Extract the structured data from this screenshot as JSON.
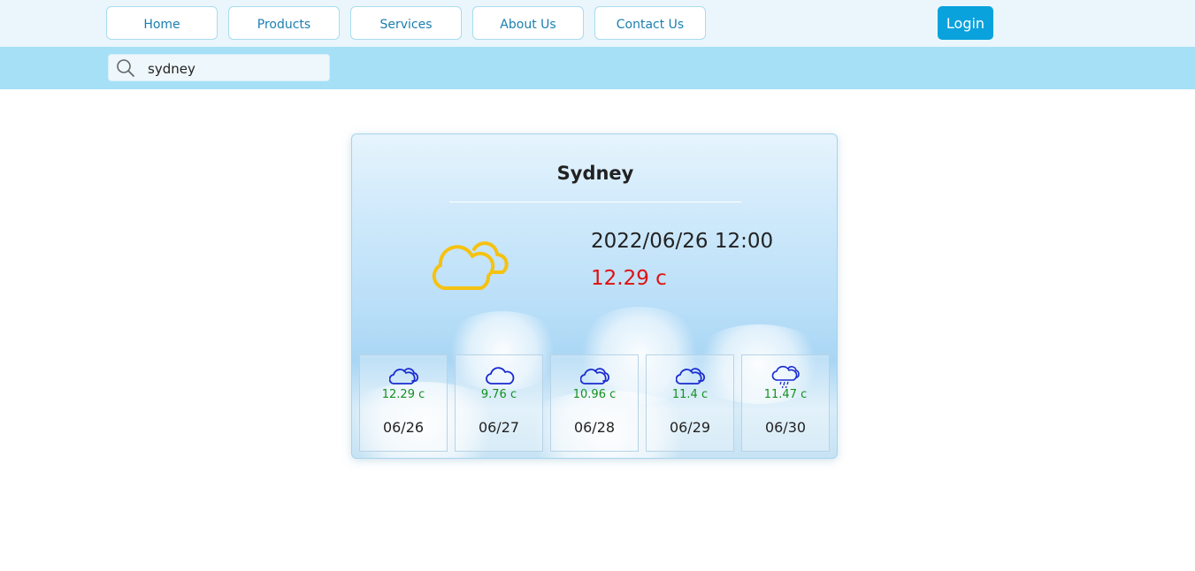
{
  "nav": {
    "items": [
      {
        "label": "Home"
      },
      {
        "label": "Products"
      },
      {
        "label": "Services"
      },
      {
        "label": "About Us"
      },
      {
        "label": "Contact Us"
      }
    ],
    "login_label": "Login"
  },
  "search": {
    "value": "sydney",
    "icon": "search-icon"
  },
  "weather": {
    "city": "Sydney",
    "datetime": "2022/06/26 12:00",
    "temperature": "12.29 c",
    "icon": "partly-cloudy-icon",
    "forecast": [
      {
        "temp": "12.29 c",
        "date": "06/26",
        "icon": "partly-cloudy-icon"
      },
      {
        "temp": "9.76 c",
        "date": "06/27",
        "icon": "cloud-icon"
      },
      {
        "temp": "10.96 c",
        "date": "06/28",
        "icon": "partly-cloudy-icon"
      },
      {
        "temp": "11.4 c",
        "date": "06/29",
        "icon": "partly-cloudy-icon"
      },
      {
        "temp": "11.47 c",
        "date": "06/30",
        "icon": "rain-icon"
      }
    ]
  },
  "colors": {
    "accent": "#0aa2dd",
    "search_bar": "#a5e0f7",
    "temp_main": "#e01010",
    "temp_forecast": "#15901f",
    "icon_main": "#f5c211",
    "icon_forecast": "#1a2bd0"
  }
}
